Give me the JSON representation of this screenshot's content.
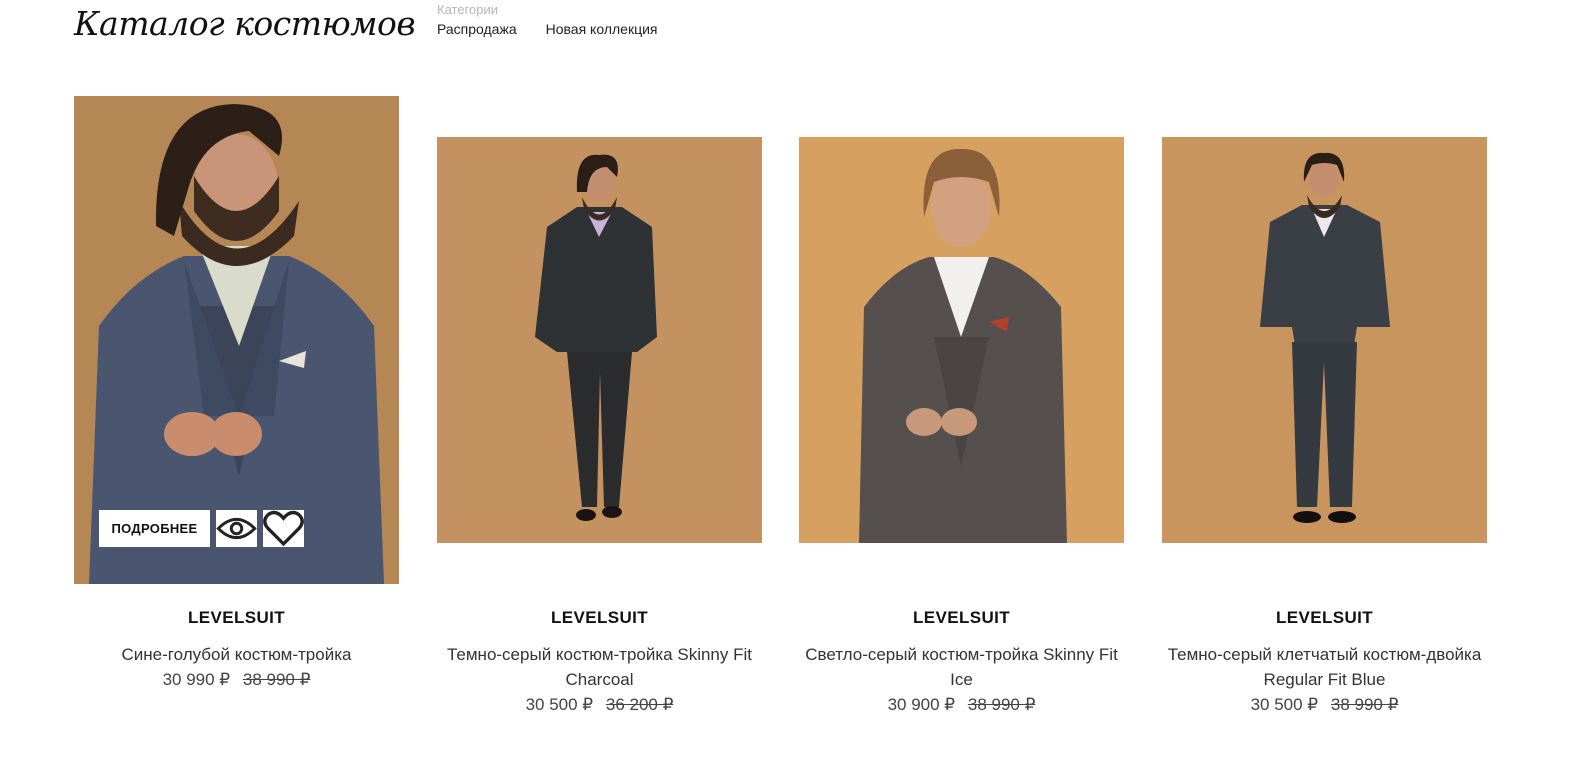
{
  "header": {
    "title": "Каталог костюмов",
    "categories_label": "Категории",
    "categories": [
      "Распродажа",
      "Новая коллекция"
    ]
  },
  "card_actions": {
    "details_label": "ПОДРОБНЕЕ",
    "view_icon": "eye-icon",
    "wishlist_icon": "heart-icon"
  },
  "products": [
    {
      "brand": "LEVELSUIT",
      "name": "Сине-голубой костюм-тройка",
      "price": "30 990 ₽",
      "old_price": "38 990 ₽"
    },
    {
      "brand": "LEVELSUIT",
      "name": "Темно-серый костюм-тройка Skinny Fit Charcoal",
      "price": "30 500 ₽",
      "old_price": "36 200 ₽"
    },
    {
      "brand": "LEVELSUIT",
      "name": "Светло-серый костюм-тройка Skinny Fit Ice",
      "price": "30 900 ₽",
      "old_price": "38 990 ₽"
    },
    {
      "brand": "LEVELSUIT",
      "name": "Темно-серый клетчатый костюм-двойка Regular Fit Blue",
      "price": "30 500 ₽",
      "old_price": "38 990 ₽"
    }
  ],
  "colors": {
    "backdrop": "#b98a55",
    "backdrop_light": "#d9a463",
    "suit_blue": "#4a5670",
    "suit_charcoal": "#2f3234",
    "suit_grey": "#55504e",
    "suit_check": "#3a3f45"
  }
}
